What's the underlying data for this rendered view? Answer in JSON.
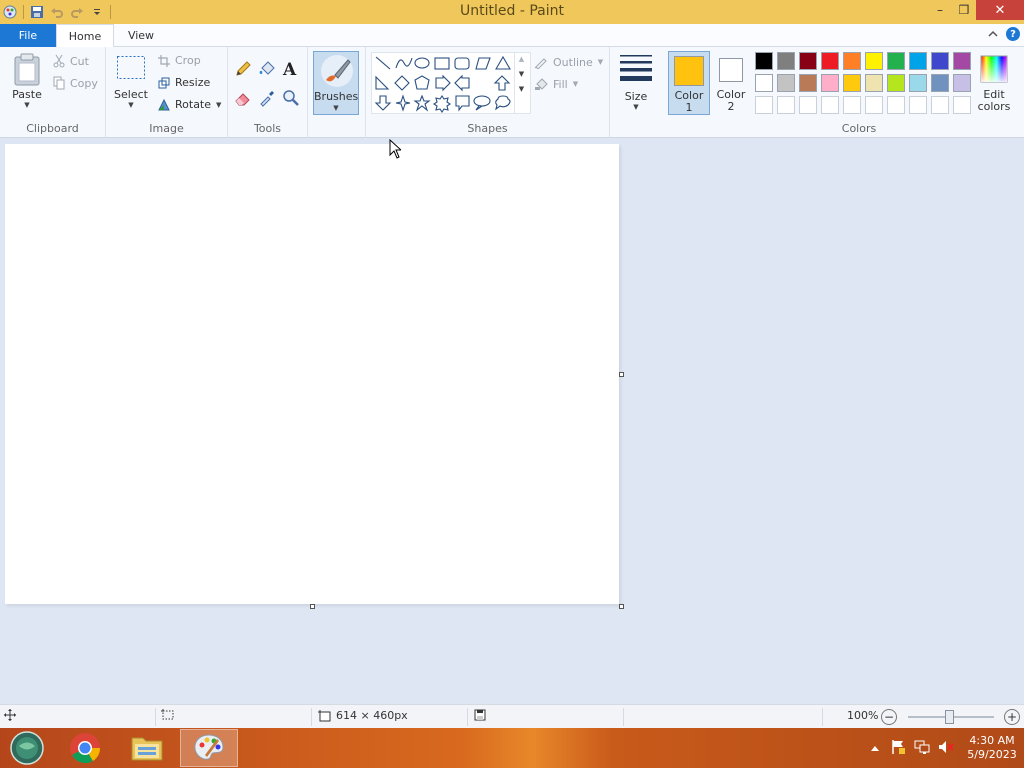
{
  "window": {
    "title": "Untitled - Paint",
    "minimize_glyph": "–",
    "maximize_glyph": "❒",
    "close_glyph": "✕"
  },
  "tabs": {
    "file": "File",
    "home": "Home",
    "view": "View",
    "help_glyph": "?"
  },
  "ribbon": {
    "clipboard": {
      "label": "Clipboard",
      "paste": "Paste",
      "cut": "Cut",
      "copy": "Copy"
    },
    "image": {
      "label": "Image",
      "select": "Select",
      "crop": "Crop",
      "resize": "Resize",
      "rotate": "Rotate"
    },
    "tools": {
      "label": "Tools",
      "text_glyph": "A"
    },
    "brushes": {
      "label": "Brushes"
    },
    "shapes": {
      "label": "Shapes",
      "outline": "Outline",
      "fill": "Fill"
    },
    "size": {
      "label": "Size"
    },
    "color1": {
      "line1": "Color",
      "line2": "1",
      "value": "#ffc20e"
    },
    "color2": {
      "line1": "Color",
      "line2": "2",
      "value": "#ffffff"
    },
    "colors": {
      "label": "Colors",
      "edit_line1": "Edit",
      "edit_line2": "colors",
      "row1": [
        "#000000",
        "#7f7f7f",
        "#880015",
        "#ed1c24",
        "#ff7f27",
        "#fff200",
        "#22b14c",
        "#00a2e8",
        "#3f48cc",
        "#a349a4"
      ],
      "row2": [
        "#ffffff",
        "#c3c3c3",
        "#b97a57",
        "#ffaec9",
        "#ffc90e",
        "#efe4b0",
        "#b5e61d",
        "#99d9ea",
        "#7092be",
        "#c8bfe7"
      ]
    }
  },
  "statusbar": {
    "dimensions": "614 × 460px",
    "zoom": "100%",
    "zoom_minus": "−",
    "zoom_plus": "+"
  },
  "taskbar": {
    "time": "4:30 AM",
    "date": "5/9/2023"
  }
}
